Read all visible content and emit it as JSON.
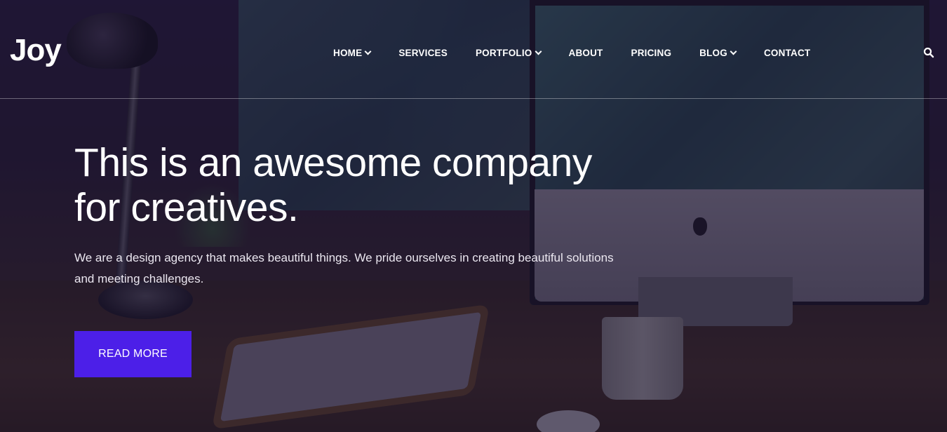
{
  "brand": {
    "logo_text": "Joy"
  },
  "nav": {
    "items": [
      {
        "label": "HOME",
        "has_dropdown": true
      },
      {
        "label": "SERVICES",
        "has_dropdown": false
      },
      {
        "label": "PORTFOLIO",
        "has_dropdown": true
      },
      {
        "label": "ABOUT",
        "has_dropdown": false
      },
      {
        "label": "PRICING",
        "has_dropdown": false
      },
      {
        "label": "BLOG",
        "has_dropdown": true
      },
      {
        "label": "CONTACT",
        "has_dropdown": false
      }
    ],
    "search_icon": "search-icon"
  },
  "hero": {
    "title_line1": "This is an awesome company",
    "title_line2": "for creatives.",
    "description_line1": "We are a design agency that makes beautiful things. We pride ourselves in creating beautiful solutions",
    "description_line2": "and meeting challenges.",
    "cta_label": "READ MORE"
  },
  "colors": {
    "accent": "#4c1fe8",
    "text": "#ffffff",
    "overlay": "#160e2c"
  }
}
